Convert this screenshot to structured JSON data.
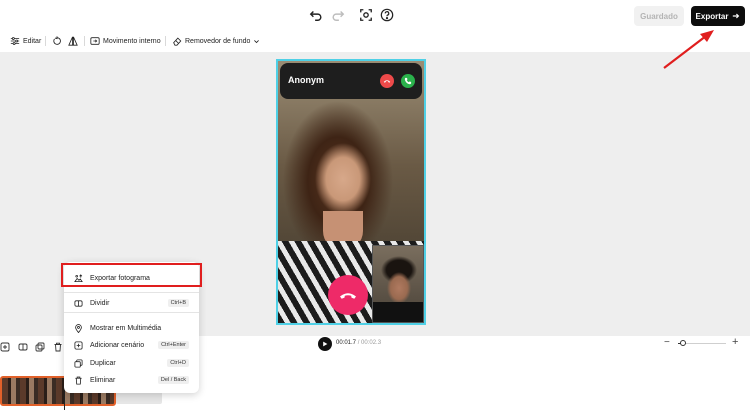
{
  "header": {
    "saved_label": "Guardado",
    "export_label": "Exportar",
    "icons": [
      "undo-icon",
      "redo-icon",
      "screenshot-icon",
      "help-icon"
    ]
  },
  "toolbar": {
    "edit_label": "Editar",
    "motion_label": "Movimento interno",
    "bg_remover_label": "Removedor de fundo"
  },
  "canvas": {
    "caller_name": "Anonym",
    "frame_color": "#4fd0e6"
  },
  "player": {
    "current_time": "00:01.7",
    "separator": " / ",
    "total_time": "00:02.3",
    "zoom_level": 0.1
  },
  "context_menu": {
    "items": [
      {
        "label": "Exportar fotograma",
        "shortcut": ""
      },
      {
        "label": "Dividir",
        "shortcut": "Ctrl+B"
      },
      {
        "label": "Mostrar em Multimédia",
        "shortcut": ""
      },
      {
        "label": "Adicionar cenário",
        "shortcut": "Ctrl+Enter"
      },
      {
        "label": "Duplicar",
        "shortcut": "Ctrl+D"
      },
      {
        "label": "Eliminar",
        "shortcut": "Del / Back"
      }
    ]
  },
  "colors": {
    "annotation": "#e01e1e",
    "hangup": "#ee2a68",
    "accept": "#2bb24c",
    "clip_border": "#e2612a"
  }
}
